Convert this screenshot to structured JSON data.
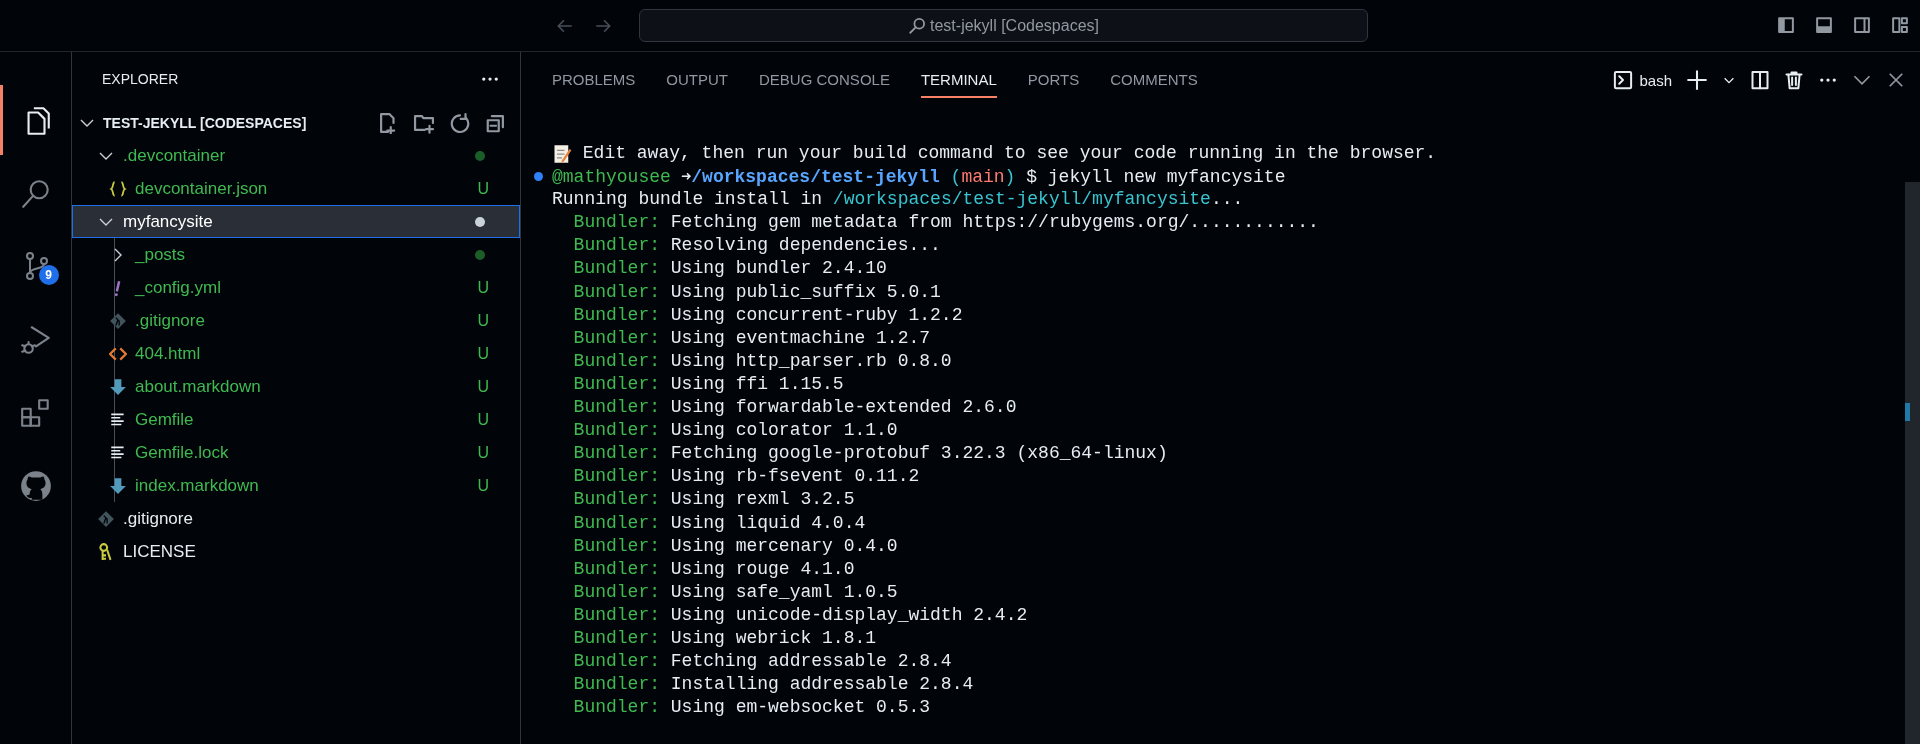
{
  "title_bar": {
    "command_center": "test-jekyll [Codespaces]"
  },
  "activity_bar": [
    {
      "kind": "explorer",
      "selected": true
    },
    {
      "kind": "search",
      "selected": false
    },
    {
      "kind": "source_control",
      "selected": false,
      "badge": "9"
    },
    {
      "kind": "run_debug",
      "selected": false
    },
    {
      "kind": "extensions",
      "selected": false
    },
    {
      "kind": "github",
      "selected": false
    }
  ],
  "sidebar": {
    "title": "EXPLORER",
    "workspace": {
      "label": "TEST-JEKYLL [CODESPACES]",
      "expanded": true,
      "children": [
        {
          "label": ".devcontainer",
          "kind": "folder",
          "expanded": true,
          "selected": false,
          "untracked": true,
          "dot": true,
          "children": [
            {
              "label": "devcontainer.json",
              "kind": "json",
              "selected": false,
              "untracked": true,
              "badge": "U"
            }
          ]
        },
        {
          "label": "myfancysite",
          "kind": "folder",
          "expanded": true,
          "selected": true,
          "untracked": true,
          "dot": true,
          "children": [
            {
              "label": "_posts",
              "kind": "folder",
              "expanded": false,
              "selected": false,
              "untracked": true,
              "dot": true
            },
            {
              "label": "_config.yml",
              "kind": "yaml",
              "selected": false,
              "untracked": true,
              "badge": "U"
            },
            {
              "label": ".gitignore",
              "kind": "git",
              "selected": false,
              "untracked": true,
              "badge": "U"
            },
            {
              "label": "404.html",
              "kind": "html",
              "selected": false,
              "untracked": true,
              "badge": "U"
            },
            {
              "label": "about.markdown",
              "kind": "markdown",
              "selected": false,
              "untracked": true,
              "badge": "U"
            },
            {
              "label": "Gemfile",
              "kind": "text",
              "selected": false,
              "untracked": true,
              "badge": "U"
            },
            {
              "label": "Gemfile.lock",
              "kind": "text",
              "selected": false,
              "untracked": true,
              "badge": "U"
            },
            {
              "label": "index.markdown",
              "kind": "markdown",
              "selected": false,
              "untracked": true,
              "badge": "U"
            }
          ]
        },
        {
          "label": ".gitignore",
          "kind": "git",
          "selected": false,
          "untracked": false
        },
        {
          "label": "LICENSE",
          "kind": "license",
          "selected": false,
          "untracked": false
        }
      ]
    }
  },
  "panel": {
    "tabs": [
      {
        "label": "PROBLEMS",
        "selected": false
      },
      {
        "label": "OUTPUT",
        "selected": false
      },
      {
        "label": "DEBUG CONSOLE",
        "selected": false
      },
      {
        "label": "TERMINAL",
        "selected": true
      },
      {
        "label": "PORTS",
        "selected": false
      },
      {
        "label": "COMMENTS",
        "selected": false
      }
    ],
    "terminal_name": "bash",
    "terminal_lines": [
      {
        "kind": "note",
        "spans": [
          {
            "text": " Edit away, then run your build command to see your code running in the browser.",
            "kind": "plain"
          }
        ]
      },
      {
        "kind": "prompt",
        "spans": [
          {
            "text": "@mathyousee",
            "kind": "user"
          },
          {
            "text": " ➜",
            "kind": "arrow"
          },
          {
            "text": "/workspaces/test-jekyll",
            "kind": "path"
          },
          {
            "text": " (",
            "kind": "paren"
          },
          {
            "text": "main",
            "kind": "branch"
          },
          {
            "text": ")",
            "kind": "paren"
          },
          {
            "text": " $ jekyll new myfancysite",
            "kind": "plain"
          }
        ]
      },
      {
        "kind": "output",
        "spans": [
          {
            "text": "Running bundle install in ",
            "kind": "plain"
          },
          {
            "text": "/workspaces/test-jekyll/myfancysite",
            "kind": "paren"
          },
          {
            "text": "...",
            "kind": "plain"
          }
        ]
      },
      {
        "kind": "bundler",
        "spans": [
          {
            "text": "Bundler:",
            "kind": "bundler"
          },
          {
            "text": " Fetching gem metadata from https://rubygems.org/............",
            "kind": "plain"
          }
        ]
      },
      {
        "kind": "bundler",
        "spans": [
          {
            "text": "Bundler:",
            "kind": "bundler"
          },
          {
            "text": " Resolving dependencies...",
            "kind": "plain"
          }
        ]
      },
      {
        "kind": "bundler",
        "spans": [
          {
            "text": "Bundler:",
            "kind": "bundler"
          },
          {
            "text": " Using bundler 2.4.10",
            "kind": "plain"
          }
        ]
      },
      {
        "kind": "bundler",
        "spans": [
          {
            "text": "Bundler:",
            "kind": "bundler"
          },
          {
            "text": " Using public_suffix 5.0.1",
            "kind": "plain"
          }
        ]
      },
      {
        "kind": "bundler",
        "spans": [
          {
            "text": "Bundler:",
            "kind": "bundler"
          },
          {
            "text": " Using concurrent-ruby 1.2.2",
            "kind": "plain"
          }
        ]
      },
      {
        "kind": "bundler",
        "spans": [
          {
            "text": "Bundler:",
            "kind": "bundler"
          },
          {
            "text": " Using eventmachine 1.2.7",
            "kind": "plain"
          }
        ]
      },
      {
        "kind": "bundler",
        "spans": [
          {
            "text": "Bundler:",
            "kind": "bundler"
          },
          {
            "text": " Using http_parser.rb 0.8.0",
            "kind": "plain"
          }
        ]
      },
      {
        "kind": "bundler",
        "spans": [
          {
            "text": "Bundler:",
            "kind": "bundler"
          },
          {
            "text": " Using ffi 1.15.5",
            "kind": "plain"
          }
        ]
      },
      {
        "kind": "bundler",
        "spans": [
          {
            "text": "Bundler:",
            "kind": "bundler"
          },
          {
            "text": " Using forwardable-extended 2.6.0",
            "kind": "plain"
          }
        ]
      },
      {
        "kind": "bundler",
        "spans": [
          {
            "text": "Bundler:",
            "kind": "bundler"
          },
          {
            "text": " Using colorator 1.1.0",
            "kind": "plain"
          }
        ]
      },
      {
        "kind": "bundler",
        "spans": [
          {
            "text": "Bundler:",
            "kind": "bundler"
          },
          {
            "text": " Fetching google-protobuf 3.22.3 (x86_64-linux)",
            "kind": "plain"
          }
        ]
      },
      {
        "kind": "bundler",
        "spans": [
          {
            "text": "Bundler:",
            "kind": "bundler"
          },
          {
            "text": " Using rb-fsevent 0.11.2",
            "kind": "plain"
          }
        ]
      },
      {
        "kind": "bundler",
        "spans": [
          {
            "text": "Bundler:",
            "kind": "bundler"
          },
          {
            "text": " Using rexml 3.2.5",
            "kind": "plain"
          }
        ]
      },
      {
        "kind": "bundler",
        "spans": [
          {
            "text": "Bundler:",
            "kind": "bundler"
          },
          {
            "text": " Using liquid 4.0.4",
            "kind": "plain"
          }
        ]
      },
      {
        "kind": "bundler",
        "spans": [
          {
            "text": "Bundler:",
            "kind": "bundler"
          },
          {
            "text": " Using mercenary 0.4.0",
            "kind": "plain"
          }
        ]
      },
      {
        "kind": "bundler",
        "spans": [
          {
            "text": "Bundler:",
            "kind": "bundler"
          },
          {
            "text": " Using rouge 4.1.0",
            "kind": "plain"
          }
        ]
      },
      {
        "kind": "bundler",
        "spans": [
          {
            "text": "Bundler:",
            "kind": "bundler"
          },
          {
            "text": " Using safe_yaml 1.0.5",
            "kind": "plain"
          }
        ]
      },
      {
        "kind": "bundler",
        "spans": [
          {
            "text": "Bundler:",
            "kind": "bundler"
          },
          {
            "text": " Using unicode-display_width 2.4.2",
            "kind": "plain"
          }
        ]
      },
      {
        "kind": "bundler",
        "spans": [
          {
            "text": "Bundler:",
            "kind": "bundler"
          },
          {
            "text": " Using webrick 1.8.1",
            "kind": "plain"
          }
        ]
      },
      {
        "kind": "bundler",
        "spans": [
          {
            "text": "Bundler:",
            "kind": "bundler"
          },
          {
            "text": " Fetching addressable 2.8.4",
            "kind": "plain"
          }
        ]
      },
      {
        "kind": "bundler",
        "spans": [
          {
            "text": "Bundler:",
            "kind": "bundler"
          },
          {
            "text": " Installing addressable 2.8.4",
            "kind": "plain"
          }
        ]
      },
      {
        "kind": "bundler",
        "spans": [
          {
            "text": "Bundler:",
            "kind": "bundler"
          },
          {
            "text": " Using em-websocket 0.5.3",
            "kind": "plain"
          }
        ]
      }
    ]
  }
}
